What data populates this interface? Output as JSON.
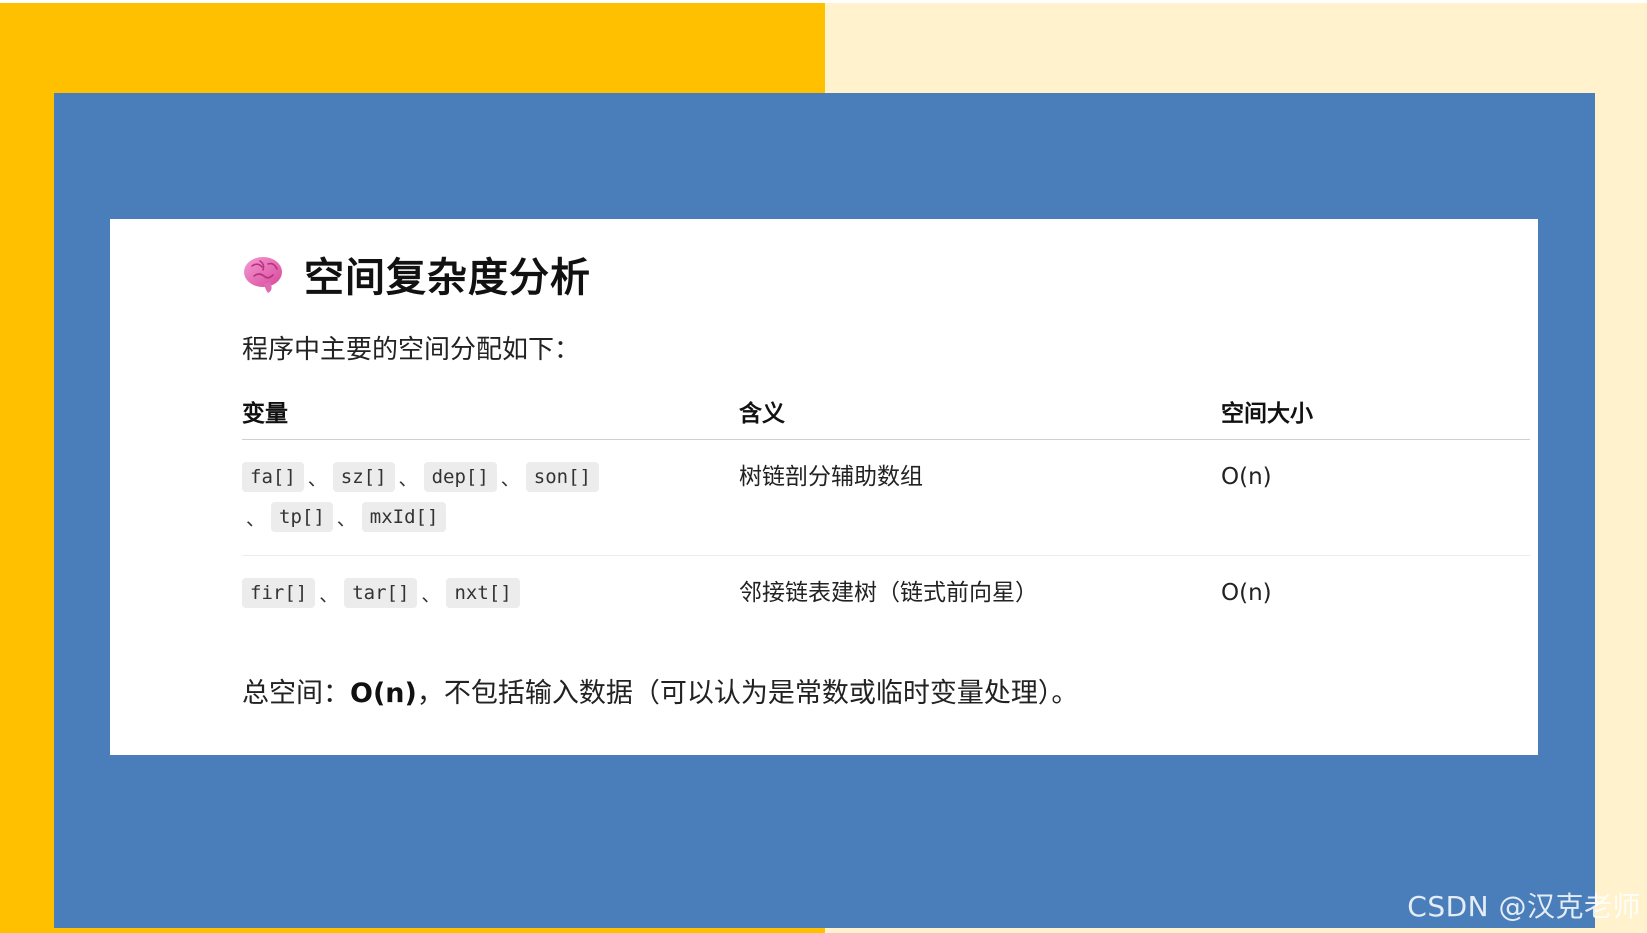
{
  "colors": {
    "frame_left": "#FFC000",
    "frame_right": "#FFF2CC",
    "panel": "#4A7EBB",
    "card": "#FFFFFF"
  },
  "heading": {
    "icon": "brain-icon",
    "title": "空间复杂度分析"
  },
  "intro": "程序中主要的空间分配如下：",
  "table": {
    "headers": [
      "变量",
      "含义",
      "空间大小"
    ],
    "rows": [
      {
        "vars": [
          "fa[]",
          "sz[]",
          "dep[]",
          "son[]",
          "tp[]",
          "mxId[]"
        ],
        "meaning": "树链剖分辅助数组",
        "space": "O(n)"
      },
      {
        "vars": [
          "fir[]",
          "tar[]",
          "nxt[]"
        ],
        "meaning": "邻接链表建树（链式前向星）",
        "space": "O(n)"
      }
    ],
    "separator": "、"
  },
  "summary": {
    "prefix": "总空间：",
    "bold": "O(n)",
    "suffix": "，不包括输入数据（可以认为是常数或临时变量处理）。"
  },
  "watermark": "CSDN @汉克老师"
}
